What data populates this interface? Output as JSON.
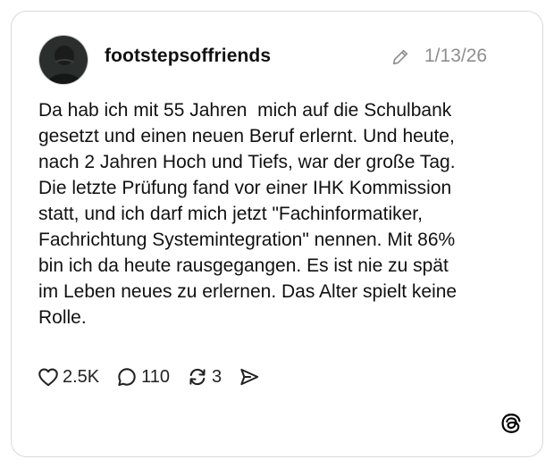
{
  "post": {
    "username": "footstepsoffriends",
    "date": "1/13/26",
    "text": "Da hab ich mit 55 Jahren  mich auf die Schulbank\ngesetzt und einen neuen Beruf erlernt. Und heute,\nnach 2 Jahren Hoch und Tiefs, war der große Tag.\nDie letzte Prüfung fand vor einer IHK Kommission\nstatt, und ich darf mich jetzt \"Fachinformatiker,\nFachrichtung Systemintegration\" nennen. Mit 86%\nbin ich da heute rausgegangen. Es ist nie zu spät\nim Leben neues zu erlernen. Das Alter spielt keine\nRolle."
  },
  "actions": {
    "likes": "2.5K",
    "replies": "110",
    "reposts": "3"
  },
  "icons": {
    "edit": "pencil-icon",
    "like": "heart-icon",
    "reply": "speech-bubble-icon",
    "repost": "repost-arrows-icon",
    "share": "send-icon",
    "brand": "threads-logo-icon"
  },
  "colors": {
    "text": "#111111",
    "muted": "#8e8e8e",
    "border": "#d9d9d9"
  }
}
